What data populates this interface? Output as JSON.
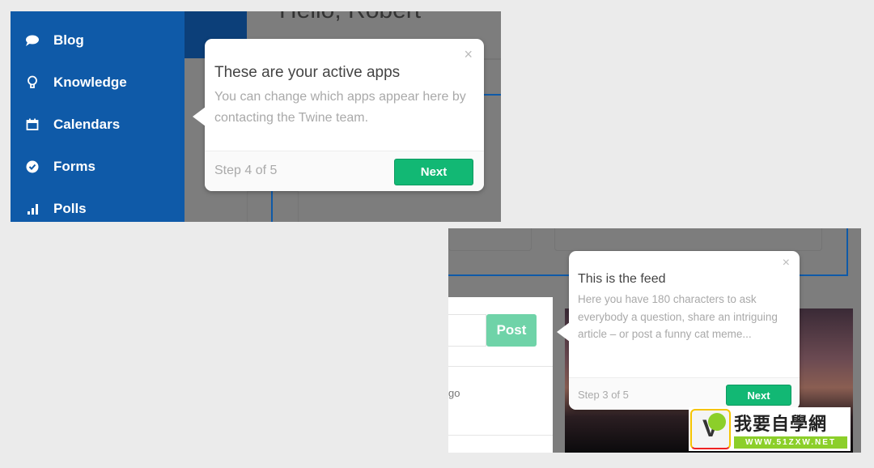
{
  "screen1": {
    "greeting": "Hello, Robert",
    "sidebar": {
      "items": [
        {
          "label": "Blog",
          "icon": "speech-bubble-icon"
        },
        {
          "label": "Knowledge",
          "icon": "lightbulb-icon"
        },
        {
          "label": "Calendars",
          "icon": "calendar-icon"
        },
        {
          "label": "Forms",
          "icon": "check-circle-icon"
        },
        {
          "label": "Polls",
          "icon": "bar-chart-icon"
        }
      ]
    },
    "tooltip": {
      "title": "These are your active apps",
      "body": "You can change which apps appear here by contacting the Twine team.",
      "close_icon": "×",
      "step": "Step 4 of 5",
      "next_label": "Next"
    }
  },
  "screen2": {
    "post_button": "Post",
    "feed_fragment": "go",
    "tooltip": {
      "title": "This is the feed",
      "body": "Here you have 180 characters to ask everybody a question, share an intriguing article – or post a funny cat meme...",
      "close_icon": "×",
      "step": "Step 3 of 5",
      "next_label": "Next"
    }
  },
  "watermark": {
    "logo_letter": "V",
    "chinese_text": "我要自學網",
    "url": "WWW.51ZXW.NET"
  },
  "colors": {
    "sidebar_blue": "#0f5aa8",
    "next_green": "#12b874",
    "overlay_gray": "#7d7d7d"
  }
}
